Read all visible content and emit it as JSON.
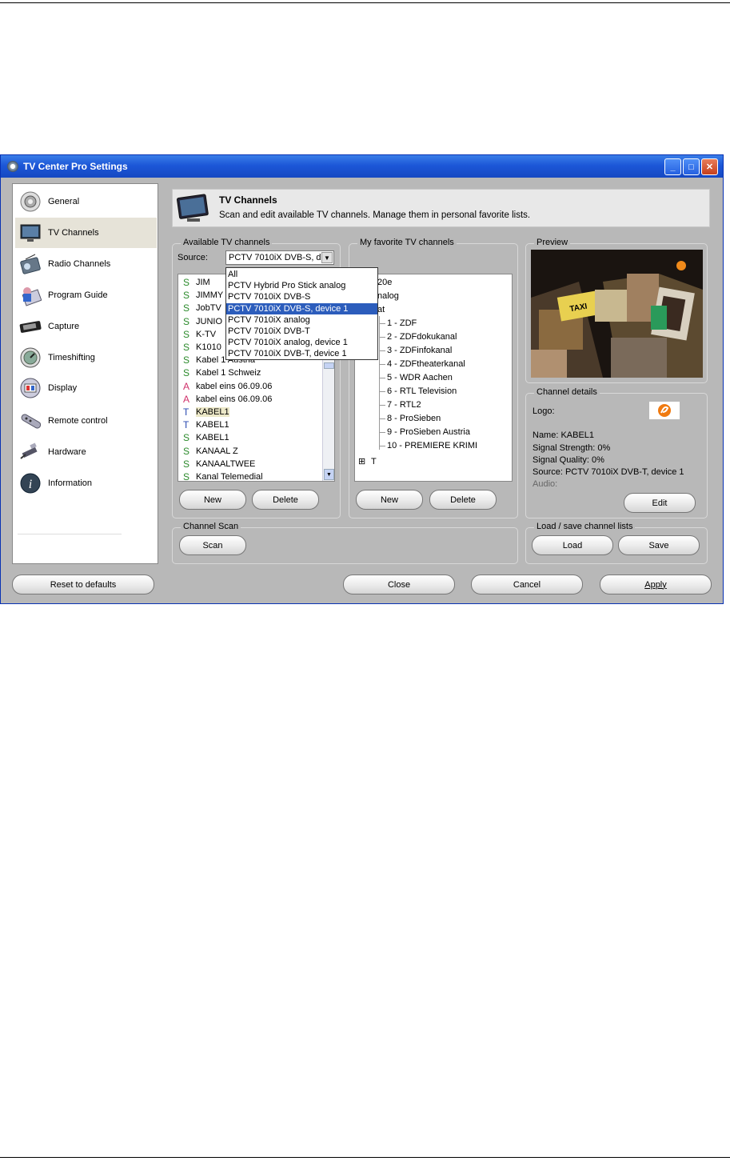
{
  "window": {
    "title": "TV Center Pro Settings"
  },
  "sidebar": {
    "items": [
      {
        "label": "General",
        "icon": "gear-icon"
      },
      {
        "label": "TV Channels",
        "icon": "tv-icon"
      },
      {
        "label": "Radio Channels",
        "icon": "radio-icon"
      },
      {
        "label": "Program Guide",
        "icon": "program-guide-icon"
      },
      {
        "label": "Capture",
        "icon": "capture-icon"
      },
      {
        "label": "Timeshifting",
        "icon": "timeshifting-icon"
      },
      {
        "label": "Display",
        "icon": "display-icon"
      },
      {
        "label": "Remote control",
        "icon": "remote-control-icon"
      },
      {
        "label": "Hardware",
        "icon": "hardware-icon"
      },
      {
        "label": "Information",
        "icon": "information-icon"
      }
    ],
    "selected": "TV Channels"
  },
  "header": {
    "title": "TV Channels",
    "subtitle": "Scan and edit available TV channels. Manage them in personal favorite lists."
  },
  "available": {
    "group_label": "Available TV channels",
    "source_label": "Source:",
    "source_value": "PCTV 7010iX DVB-S, d",
    "channels": [
      {
        "type": "S",
        "name": "JIM"
      },
      {
        "type": "S",
        "name": "JIMMY"
      },
      {
        "type": "S",
        "name": "JobTV"
      },
      {
        "type": "S",
        "name": "JUNIO"
      },
      {
        "type": "S",
        "name": "K-TV"
      },
      {
        "type": "S",
        "name": "K1010"
      },
      {
        "type": "S",
        "name": "Kabel 1 Austria"
      },
      {
        "type": "S",
        "name": "Kabel 1 Schweiz"
      },
      {
        "type": "A",
        "name": "kabel eins 06.09.06"
      },
      {
        "type": "A",
        "name": "kabel eins 06.09.06"
      },
      {
        "type": "T",
        "name": "KABEL1"
      },
      {
        "type": "T",
        "name": "KABEL1"
      },
      {
        "type": "S",
        "name": "KABEL1"
      },
      {
        "type": "S",
        "name": "KANAAL Z"
      },
      {
        "type": "S",
        "name": "KANAALTWEE"
      },
      {
        "type": "S",
        "name": "Kanal Telemedial"
      }
    ],
    "selected_index": 10,
    "new_label": "New",
    "delete_label": "Delete"
  },
  "source_dropdown": {
    "options": [
      "All",
      "PCTV Hybrid Pro Stick analog",
      "PCTV 7010iX DVB-S",
      "PCTV 7010iX DVB-S, device 1",
      "PCTV 7010iX analog",
      "PCTV 7010iX DVB-T",
      "PCTV 7010iX analog, device 1",
      "PCTV 7010iX DVB-T, device 1"
    ],
    "selected_index": 3
  },
  "favorites": {
    "group_label": "My favorite TV channels",
    "top_items": [
      "20e",
      "nalog",
      "at"
    ],
    "channels": [
      "1 - ZDF",
      "2 - ZDFdokukanal",
      "3 - ZDFinfokanal",
      "4 - ZDFtheaterkanal",
      "5 - WDR Aachen",
      "6 - RTL Television",
      "7 - RTL2",
      "8 - ProSieben",
      "9 - ProSieben Austria",
      "10 - PREMIERE KRIMI"
    ],
    "collapsed_node": "T",
    "expander_symbol": "⊞",
    "new_label": "New",
    "delete_label": "Delete"
  },
  "preview": {
    "group_label": "Preview",
    "taxi_text": "TAXI"
  },
  "channel_details": {
    "group_label": "Channel details",
    "logo_label": "Logo:",
    "name": "Name: KABEL1",
    "signal_strength": "Signal Strength: 0%",
    "signal_quality": "Signal Quality: 0%",
    "source": "Source: PCTV 7010iX DVB-T, device 1",
    "audio_label": "Audio:",
    "edit_label": "Edit"
  },
  "channel_scan": {
    "group_label": "Channel Scan",
    "scan_label": "Scan"
  },
  "load_save": {
    "group_label": "Load / save channel lists",
    "load_label": "Load",
    "save_label": "Save"
  },
  "footer": {
    "reset_label": "Reset to defaults",
    "close_label": "Close",
    "cancel_label": "Cancel",
    "apply_label": "Apply"
  },
  "colors": {
    "titlebar": "#1c57d8",
    "selection": "#2c5dbc",
    "dialog_bg": "#b8b8b8"
  }
}
